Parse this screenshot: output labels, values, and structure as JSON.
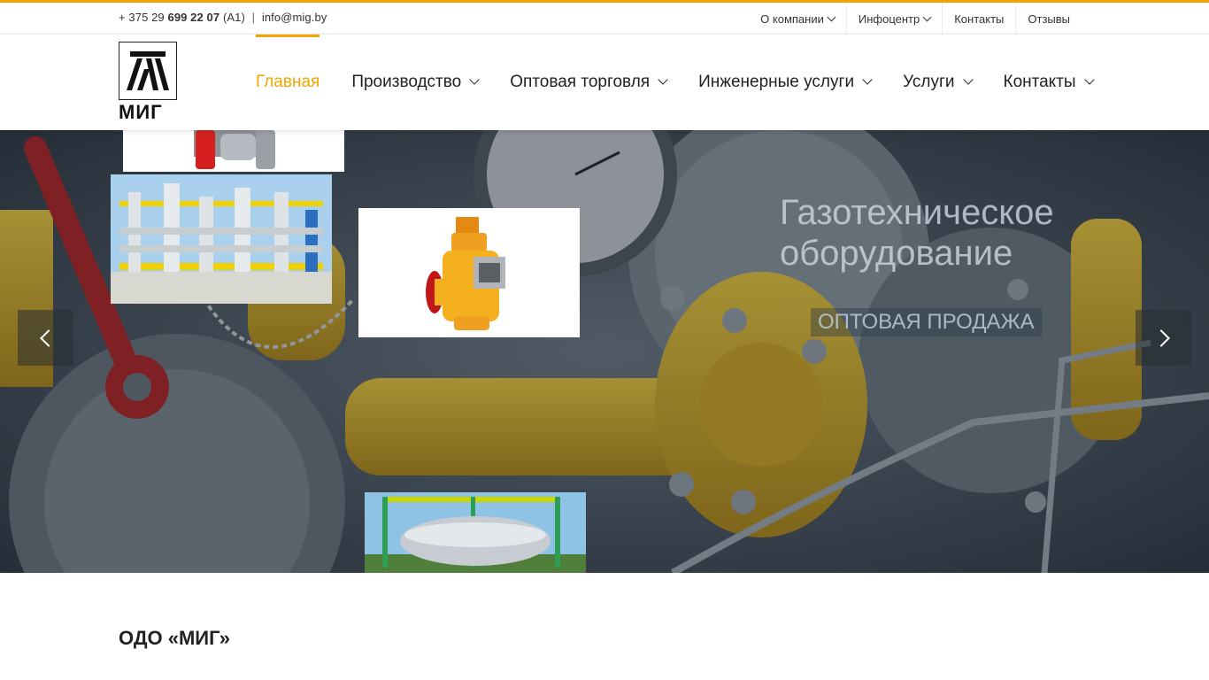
{
  "topbar": {
    "phone_prefix": "+ 375 29 ",
    "phone_number": "699 22 07",
    "phone_operator": "(A1)",
    "separator": "|",
    "email": "info@mig.by",
    "menu": [
      {
        "label": "О компании",
        "dropdown": true
      },
      {
        "label": "Инфоцентр",
        "dropdown": true
      },
      {
        "label": "Контакты",
        "dropdown": false
      },
      {
        "label": "Отзывы",
        "dropdown": false
      }
    ]
  },
  "header": {
    "logo_text": "МИГ",
    "nav": [
      {
        "label": "Главная",
        "active": true,
        "dropdown": false
      },
      {
        "label": "Производство",
        "active": false,
        "dropdown": true
      },
      {
        "label": "Оптовая торговля",
        "active": false,
        "dropdown": true
      },
      {
        "label": "Инженерные услуги",
        "active": false,
        "dropdown": true
      },
      {
        "label": "Услуги",
        "active": false,
        "dropdown": true
      },
      {
        "label": "Контакты",
        "active": false,
        "dropdown": true
      }
    ]
  },
  "hero": {
    "title_line1": "Газотехническое",
    "title_line2": "оборудование",
    "subtitle": "ОПТОВАЯ ПРОДАЖА",
    "prev_icon": "chevron-left-icon",
    "next_icon": "chevron-right-icon"
  },
  "content": {
    "company_title": "ОДО «МИГ»"
  },
  "colors": {
    "accent": "#f0a500",
    "hero_bg": "#3a4550",
    "pipe_yellow": "#e6b81e",
    "text": "#222222"
  }
}
